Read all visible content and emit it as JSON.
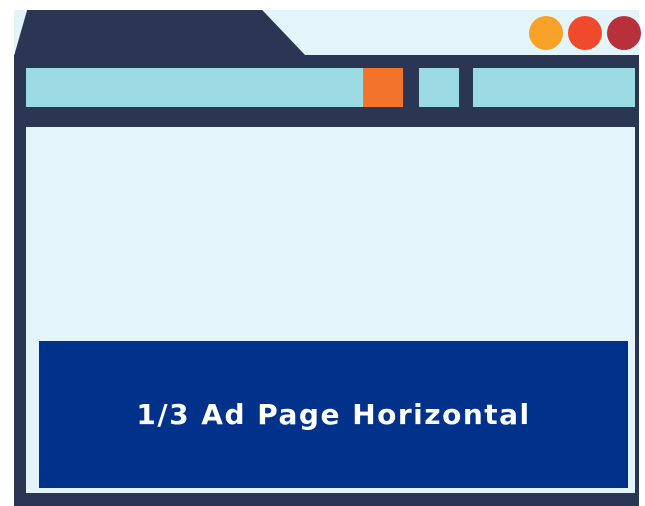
{
  "ad": {
    "label": "1/3 Ad Page Horizontal"
  },
  "window_controls": {
    "dot_colors": [
      "#f8a22a",
      "#ef4a2c",
      "#b7303a"
    ]
  },
  "colors": {
    "frame": "#2b3655",
    "page_background": "#e3f4fa",
    "address_bar": "#9cdbe3",
    "accent_button": "#f37329",
    "ad_background": "#00318b"
  }
}
